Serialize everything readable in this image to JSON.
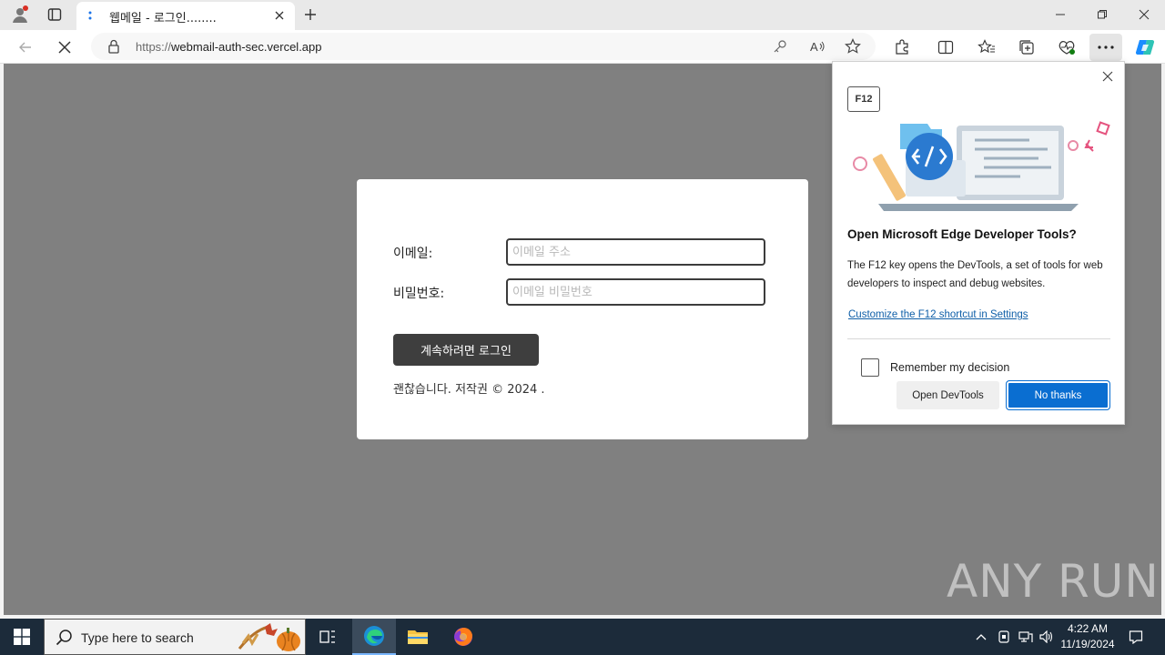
{
  "browser": {
    "tab_title": "웹메일 - 로그인........",
    "url_prefix": "https://",
    "url_domain": "webmail-auth-sec.vercel.app"
  },
  "login": {
    "email_label": "이메일:",
    "email_placeholder": "이메일 주소",
    "password_label": "비밀번호:",
    "password_placeholder": "이메일 비밀번호",
    "button": "계속하려면 로그인",
    "copyright": "괜찮습니다. 저작권 © 2024 ."
  },
  "devtools_popup": {
    "key": "F12",
    "title": "Open Microsoft Edge Developer Tools?",
    "body": "The F12 key opens the DevTools, a set of tools for web developers to inspect and debug websites.",
    "link": "Customize the F12 shortcut in Settings",
    "checkbox": "Remember my decision",
    "open_button": "Open DevTools",
    "no_button": "No thanks"
  },
  "watermark": "ANY RUN",
  "taskbar": {
    "search_placeholder": "Type here to search",
    "time": "4:22 AM",
    "date": "11/19/2024"
  },
  "colors": {
    "page_bg": "#808080",
    "button_dark": "#3e3e3e",
    "primary_blue": "#0a6ed1",
    "taskbar": "#1c2b3a"
  }
}
